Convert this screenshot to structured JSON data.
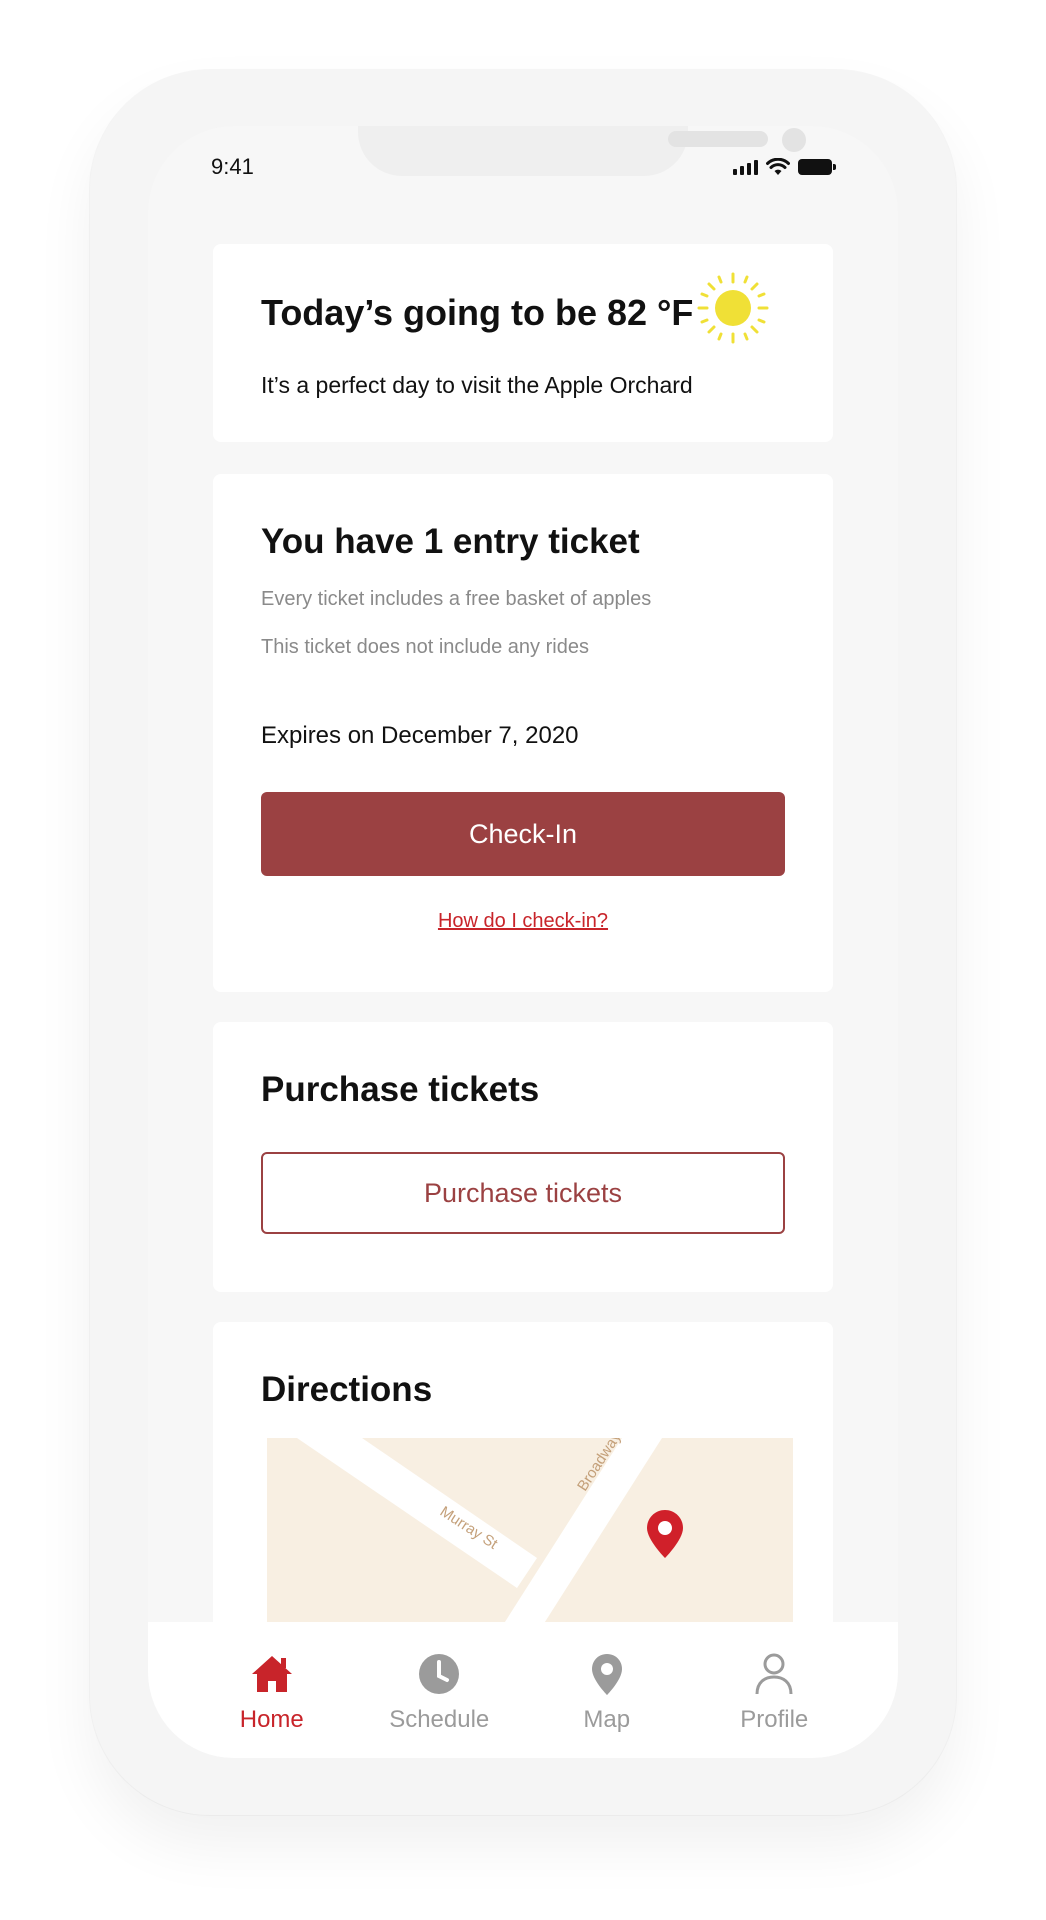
{
  "status_bar": {
    "time": "9:41"
  },
  "weather_card": {
    "title": "Today’s going to be 82 °F",
    "subtitle": "It’s a perfect day to visit the Apple Orchard",
    "icon": "sun-icon"
  },
  "ticket_card": {
    "title": "You have 1 entry ticket",
    "line1": "Every ticket includes a free basket of apples",
    "line2": "This ticket does not include any rides",
    "expires": "Expires on December 7, 2020",
    "checkin_label": "Check-In",
    "help_link": "How do I check-in?"
  },
  "purchase_card": {
    "title": "Purchase tickets",
    "button_label": "Purchase tickets"
  },
  "directions_card": {
    "title": "Directions",
    "map": {
      "street_1": "Murray St",
      "street_2": "Broadway",
      "pin_icon": "location-pin-icon"
    }
  },
  "bottom_nav": {
    "items": [
      {
        "label": "Home",
        "icon": "home-icon",
        "active": true
      },
      {
        "label": "Schedule",
        "icon": "clock-icon",
        "active": false
      },
      {
        "label": "Map",
        "icon": "map-pin-icon",
        "active": false
      },
      {
        "label": "Profile",
        "icon": "person-icon",
        "active": false
      }
    ]
  },
  "colors": {
    "accent": "#9b4142",
    "active_nav": "#c8242a",
    "sun": "#f0e036",
    "map_bg": "#f8efe2",
    "pin": "#d0202a"
  }
}
